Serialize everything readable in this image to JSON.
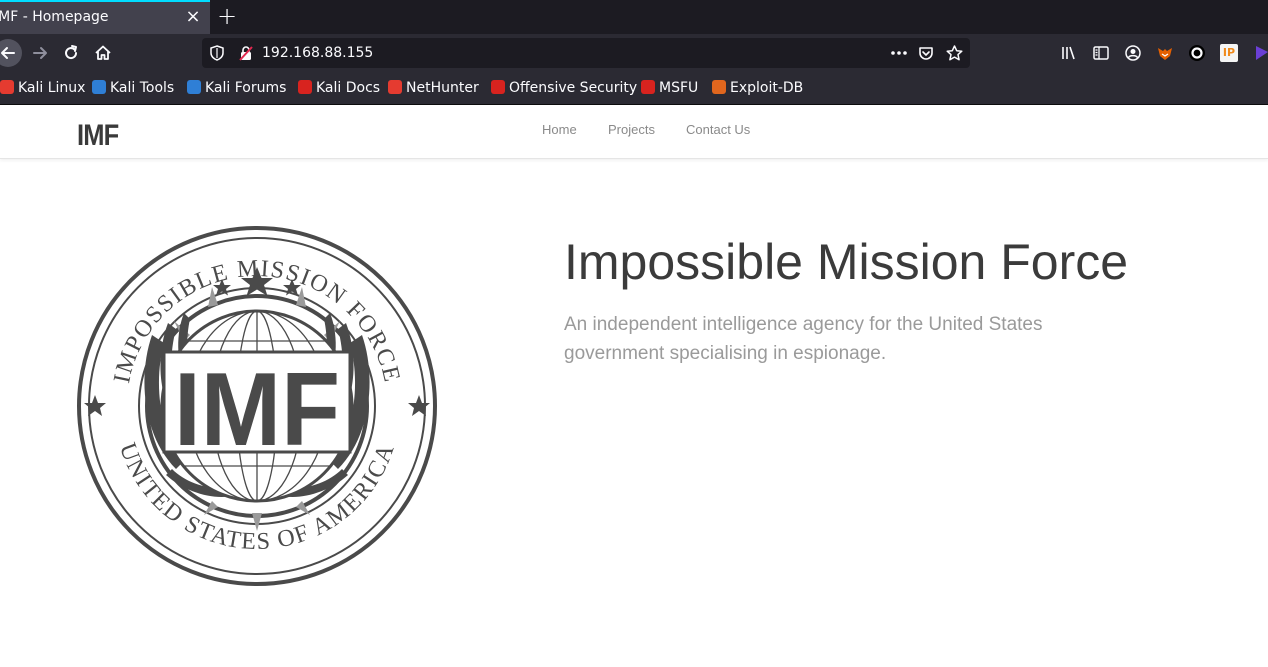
{
  "browser": {
    "tab_title": "IMF - Homepage",
    "tab_close": "×",
    "new_tab": "+",
    "url": "192.168.88.155",
    "bookmarks": [
      {
        "label": "Kali Linux",
        "icon": "kali-dragon-icon",
        "color": "#e53b30"
      },
      {
        "label": "Kali Tools",
        "icon": "kali-tools-icon",
        "color": "#2f7fd6"
      },
      {
        "label": "Kali Forums",
        "icon": "kali-forums-icon",
        "color": "#2f7fd6"
      },
      {
        "label": "Kali Docs",
        "icon": "kali-docs-icon",
        "color": "#d8231f"
      },
      {
        "label": "NetHunter",
        "icon": "nethunter-icon",
        "color": "#e53b30"
      },
      {
        "label": "Offensive Security",
        "icon": "offsec-icon",
        "color": "#d8231f"
      },
      {
        "label": "MSFU",
        "icon": "msfu-icon",
        "color": "#d8231f"
      },
      {
        "label": "Exploit-DB",
        "icon": "exploit-db-icon",
        "color": "#e0661e"
      }
    ]
  },
  "site": {
    "logo": "IMF",
    "menu": [
      "Home",
      "Projects",
      "Contact Us"
    ],
    "hero_title": "Impossible Mission Force",
    "hero_description": "An independent intelligence agency for the United States government specialising in espionage.",
    "seal": {
      "top_text": "IMPOSSIBLE MISSION FORCE",
      "bottom_text": "UNITED STATES OF AMERICA",
      "center_text": "IMF",
      "color": "#4a4a4a"
    }
  }
}
